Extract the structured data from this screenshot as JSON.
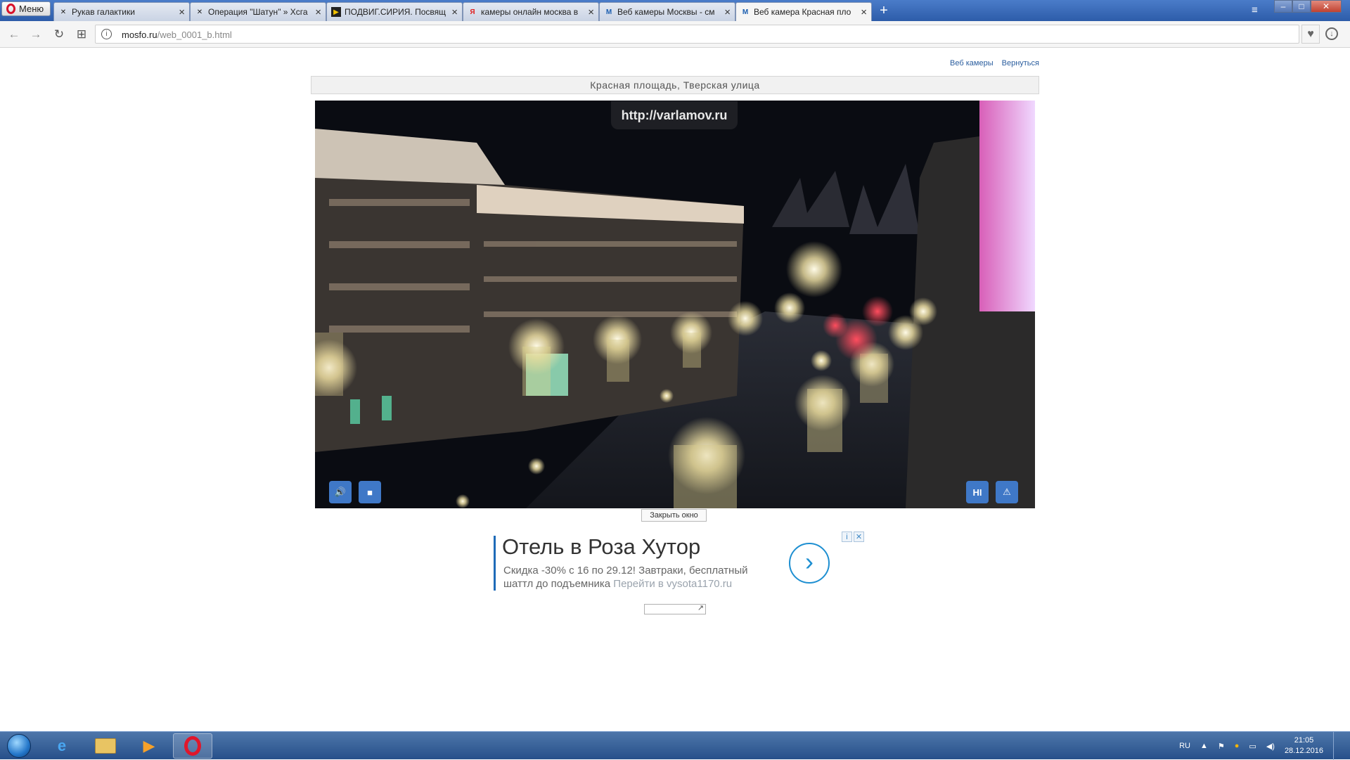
{
  "browser": {
    "menu_label": "Меню",
    "tabs": [
      {
        "title": "Рукав галактики",
        "favicon": "alien-icon"
      },
      {
        "title": "Операция \"Шатун\" » Хсга",
        "favicon": "alien-icon"
      },
      {
        "title": "ПОДВИГ.СИРИЯ. Посвящ",
        "favicon": "play-icon"
      },
      {
        "title": "камеры онлайн москва в",
        "favicon": "yandex-icon"
      },
      {
        "title": "Веб камеры Москвы - см",
        "favicon": "m-icon"
      },
      {
        "title": "Веб камера Красная пло",
        "favicon": "m-icon"
      }
    ],
    "url_domain": "mosfo.ru",
    "url_path": "/web_0001_b.html"
  },
  "page": {
    "links": [
      "Веб камеры",
      "Вернуться"
    ],
    "title": "Красная площадь, Тверская улица",
    "watermark": "http://varlamov.ru",
    "hd_label": "HI",
    "close_window": "Закрыть окно"
  },
  "ad": {
    "headline": "Отель в Роза Хутор",
    "body": "Скидка -30% с 16 по 29.12! Завтраки, бесплатный шаттл до подъемника",
    "link": "Перейти в vysota1170.ru"
  },
  "taskbar": {
    "lang": "RU",
    "time": "21:05",
    "date": "28.12.2016"
  },
  "colors": {
    "tabbar": "#2d5ca9",
    "link": "#2a5d9e",
    "video_button": "#3f78c7",
    "ad_accent": "#1e8fd1"
  }
}
